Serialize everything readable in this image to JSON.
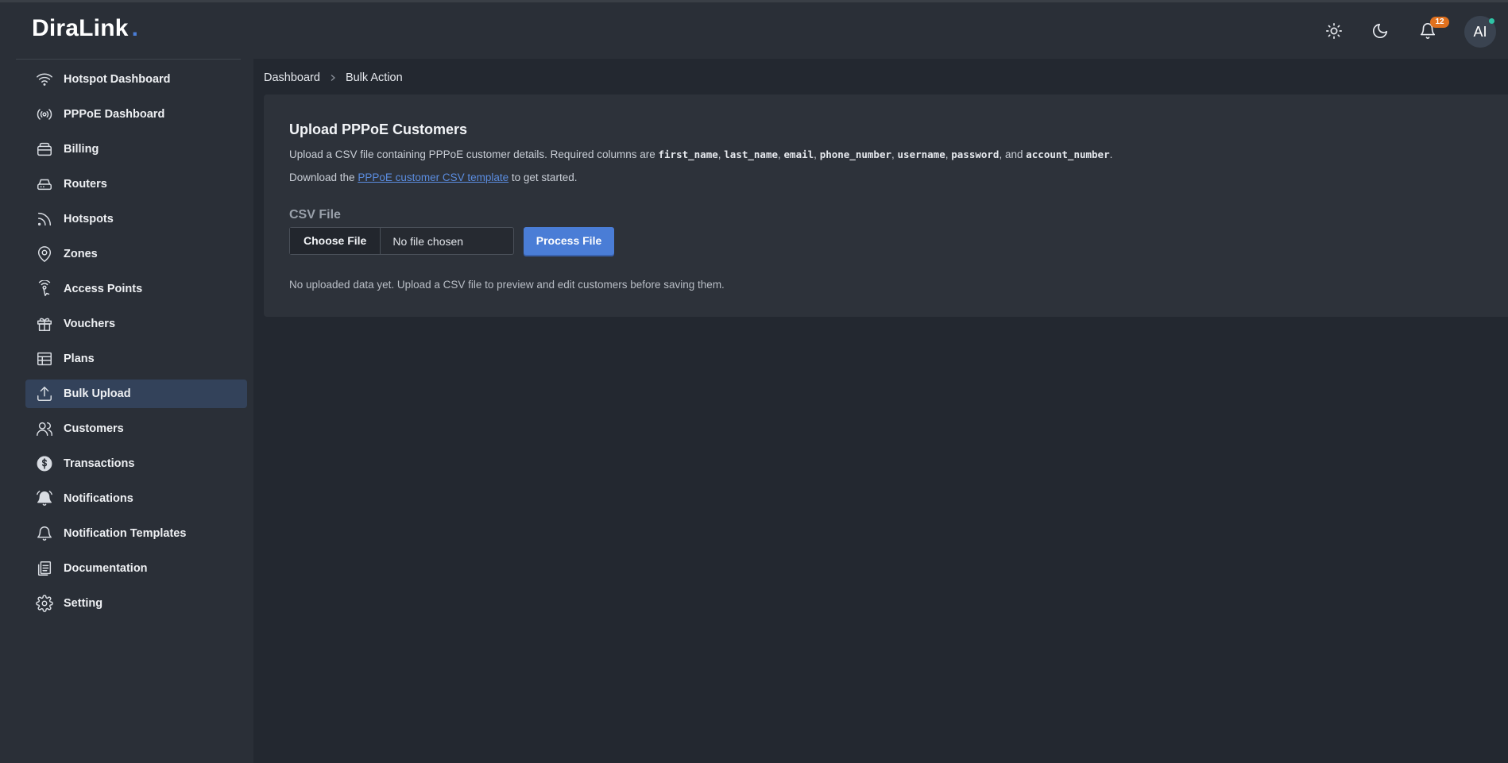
{
  "app": {
    "name": "DiraLink",
    "logo_dot": "."
  },
  "header": {
    "notification_count": "12",
    "avatar_initials": "AI",
    "icons": [
      "sun-icon",
      "moon-icon",
      "bell-icon"
    ]
  },
  "sidebar": {
    "items": [
      {
        "label": "Hotspot Dashboard",
        "icon": "wifi-icon"
      },
      {
        "label": "PPPoE Dashboard",
        "icon": "broadcast-icon"
      },
      {
        "label": "Billing",
        "icon": "billing-icon"
      },
      {
        "label": "Routers",
        "icon": "router-icon"
      },
      {
        "label": "Hotspots",
        "icon": "rss-icon"
      },
      {
        "label": "Zones",
        "icon": "map-pin-icon"
      },
      {
        "label": "Access Points",
        "icon": "access-point-icon"
      },
      {
        "label": "Vouchers",
        "icon": "gift-icon"
      },
      {
        "label": "Plans",
        "icon": "table-icon"
      },
      {
        "label": "Bulk Upload",
        "icon": "upload-icon",
        "active": true
      },
      {
        "label": "Customers",
        "icon": "users-icon"
      },
      {
        "label": "Transactions",
        "icon": "dollar-icon"
      },
      {
        "label": "Notifications",
        "icon": "bell-ringing-icon"
      },
      {
        "label": "Notification Templates",
        "icon": "bell-outline-icon"
      },
      {
        "label": "Documentation",
        "icon": "document-icon"
      },
      {
        "label": "Setting",
        "icon": "gear-icon"
      }
    ]
  },
  "breadcrumb": {
    "home": "Dashboard",
    "current": "Bulk Action"
  },
  "card": {
    "title": "Upload PPPoE Customers",
    "desc_prefix": "Upload a CSV file containing PPPoE customer details. Required columns are ",
    "columns": [
      "first_name",
      "last_name",
      "email",
      "phone_number",
      "username",
      "password",
      "account_number"
    ],
    "sep": ", ",
    "and": ", and ",
    "period": ".",
    "download_prefix": "Download the ",
    "download_link": "PPPoE customer CSV template",
    "download_suffix": " to get started.",
    "field_label": "CSV File",
    "choose_file": "Choose File",
    "no_file": "No file chosen",
    "process_button": "Process File",
    "empty_message": "No uploaded data yet. Upload a CSV file to preview and edit customers before saving them."
  },
  "colors": {
    "accent": "#4a7dd6",
    "badge": "#e0711e",
    "online_dot": "#2fc4a6",
    "active_item_bg": "#33425a"
  }
}
